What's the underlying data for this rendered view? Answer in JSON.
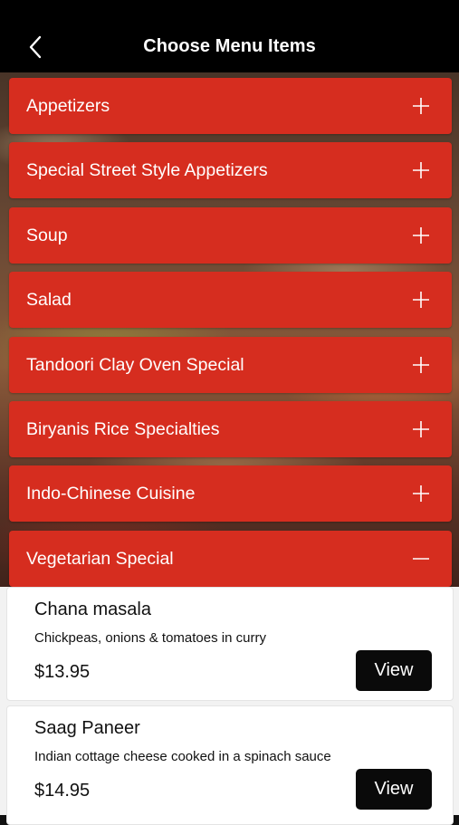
{
  "header": {
    "title": "Choose Menu Items"
  },
  "categories": [
    {
      "label": "Appetizers",
      "expanded": false
    },
    {
      "label": "Special Street Style Appetizers",
      "expanded": false
    },
    {
      "label": "Soup",
      "expanded": false
    },
    {
      "label": "Salad",
      "expanded": false
    },
    {
      "label": "Tandoori Clay Oven Special",
      "expanded": false
    },
    {
      "label": "Biryanis Rice Specialties",
      "expanded": false
    },
    {
      "label": "Indo-Chinese Cuisine",
      "expanded": false
    },
    {
      "label": "Vegetarian Special",
      "expanded": true
    }
  ],
  "items": [
    {
      "name": "Chana masala",
      "description": "Chickpeas, onions & tomatoes in curry",
      "price": "$13.95",
      "button": "View"
    },
    {
      "name": "Saag Paneer",
      "description": "Indian cottage cheese cooked in a spinach sauce",
      "price": "$14.95",
      "button": "View"
    }
  ],
  "colors": {
    "category_bg": "#d62d1f",
    "header_bg": "#000000",
    "button_bg": "#0a0a0a"
  },
  "icons": {
    "back": "chevron-left-icon",
    "collapsed": "plus-icon",
    "expanded": "minus-icon"
  }
}
